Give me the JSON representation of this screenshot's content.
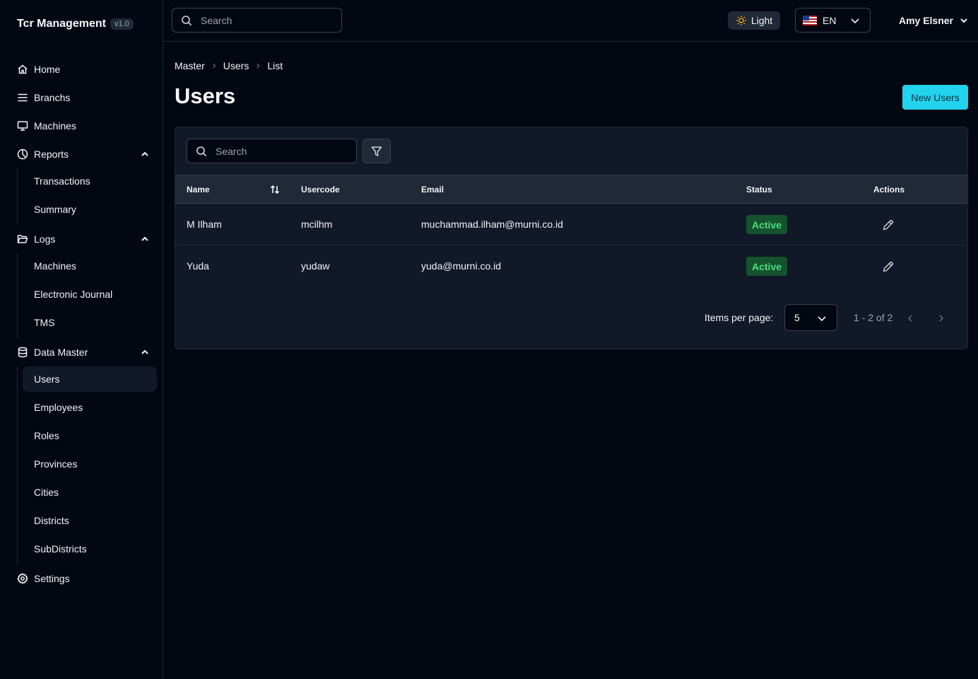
{
  "app": {
    "title": "Tcr Management",
    "version": "v1.0"
  },
  "topbar": {
    "search_placeholder": "Search",
    "theme_label": "Light",
    "language": "EN",
    "user_name": "Amy Elsner"
  },
  "sidebar": {
    "home": "Home",
    "branchs": "Branchs",
    "machines": "Machines",
    "reports": {
      "label": "Reports",
      "items": [
        "Transactions",
        "Summary"
      ]
    },
    "logs": {
      "label": "Logs",
      "items": [
        "Machines",
        "Electronic Journal",
        "TMS"
      ]
    },
    "data_master": {
      "label": "Data Master",
      "items": [
        "Users",
        "Employees",
        "Roles",
        "Provinces",
        "Cities",
        "Districts",
        "SubDistricts"
      ]
    },
    "settings": "Settings"
  },
  "breadcrumb": [
    "Master",
    "Users",
    "List"
  ],
  "page": {
    "title": "Users",
    "new_button": "New Users"
  },
  "table": {
    "search_placeholder": "Search",
    "columns": {
      "name": "Name",
      "usercode": "Usercode",
      "email": "Email",
      "status": "Status",
      "actions": "Actions"
    },
    "rows": [
      {
        "name": "M Ilham",
        "usercode": "mcilhm",
        "email": "muchammad.ilham@murni.co.id",
        "status": "Active"
      },
      {
        "name": "Yuda",
        "usercode": "yudaw",
        "email": "yuda@murni.co.id",
        "status": "Active"
      }
    ]
  },
  "pagination": {
    "label": "Items per page:",
    "per_page": "5",
    "range": "1 - 2 of 2"
  },
  "colors": {
    "accent": "#22d3ee",
    "active_badge_bg": "#14532d",
    "active_badge_text": "#4ade80"
  }
}
